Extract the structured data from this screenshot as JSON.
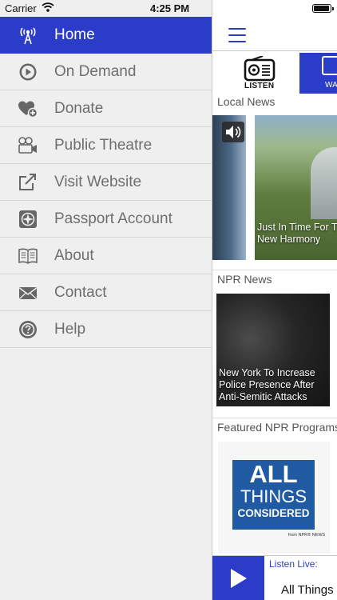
{
  "status_bar": {
    "carrier": "Carrier",
    "time": "4:25 PM"
  },
  "menu": {
    "items": [
      {
        "label": "Home",
        "icon": "antenna-icon",
        "active": true
      },
      {
        "label": "On Demand",
        "icon": "play-circle-icon",
        "active": false
      },
      {
        "label": "Donate",
        "icon": "heart-plus-icon",
        "active": false
      },
      {
        "label": "Public Theatre",
        "icon": "film-camera-icon",
        "active": false
      },
      {
        "label": "Visit Website",
        "icon": "external-link-icon",
        "active": false
      },
      {
        "label": "Passport Account",
        "icon": "compass-icon",
        "active": false
      },
      {
        "label": "About",
        "icon": "book-icon",
        "active": false
      },
      {
        "label": "Contact",
        "icon": "envelope-icon",
        "active": false
      },
      {
        "label": "Help",
        "icon": "question-circle-icon",
        "active": false
      }
    ]
  },
  "main": {
    "tabs": {
      "listen": "LISTEN",
      "watch": "WA"
    },
    "local_news": {
      "title": "Local News",
      "card_caption_line1": "Just In Time For T",
      "card_caption_line2": "New Harmony"
    },
    "npr_news": {
      "title": "NPR News",
      "card_caption_line1": "New York To Increase",
      "card_caption_line2": "Police Presence After",
      "card_caption_line3": "Anti-Semitic Attacks"
    },
    "featured": {
      "title": "Featured NPR Programs",
      "logo_line1": "ALL",
      "logo_line2": "THINGS",
      "logo_line3": "CONSIDERED",
      "logo_from": "from NPR® NEWS"
    },
    "player": {
      "listen_live": "Listen Live:",
      "now_playing": "All Things"
    }
  },
  "colors": {
    "accent": "#2b3cc9",
    "menu_bg": "#efefef",
    "menu_text": "#6e6e6e",
    "atc_blue": "#1f5aa3"
  }
}
